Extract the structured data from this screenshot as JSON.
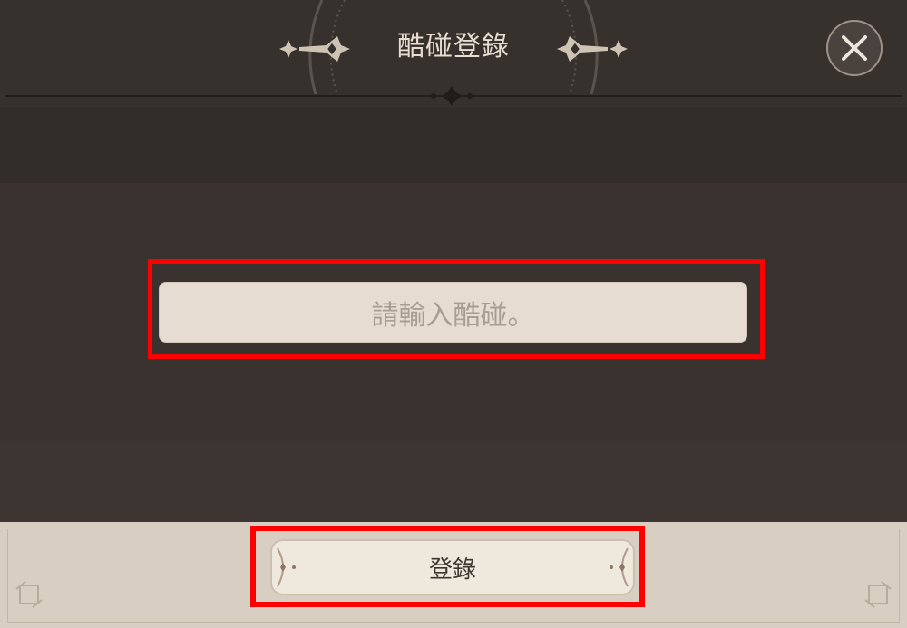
{
  "dialog": {
    "title": "酷碰登錄",
    "close_icon": "close-icon"
  },
  "coupon_input": {
    "placeholder": "請輸入酷碰。"
  },
  "login_button": {
    "label": "登錄"
  },
  "colors": {
    "highlight": "#ff0000",
    "panel_dark": "#352f2c",
    "panel_light": "#d8cfc2",
    "input_bg": "#e6dcd1"
  }
}
